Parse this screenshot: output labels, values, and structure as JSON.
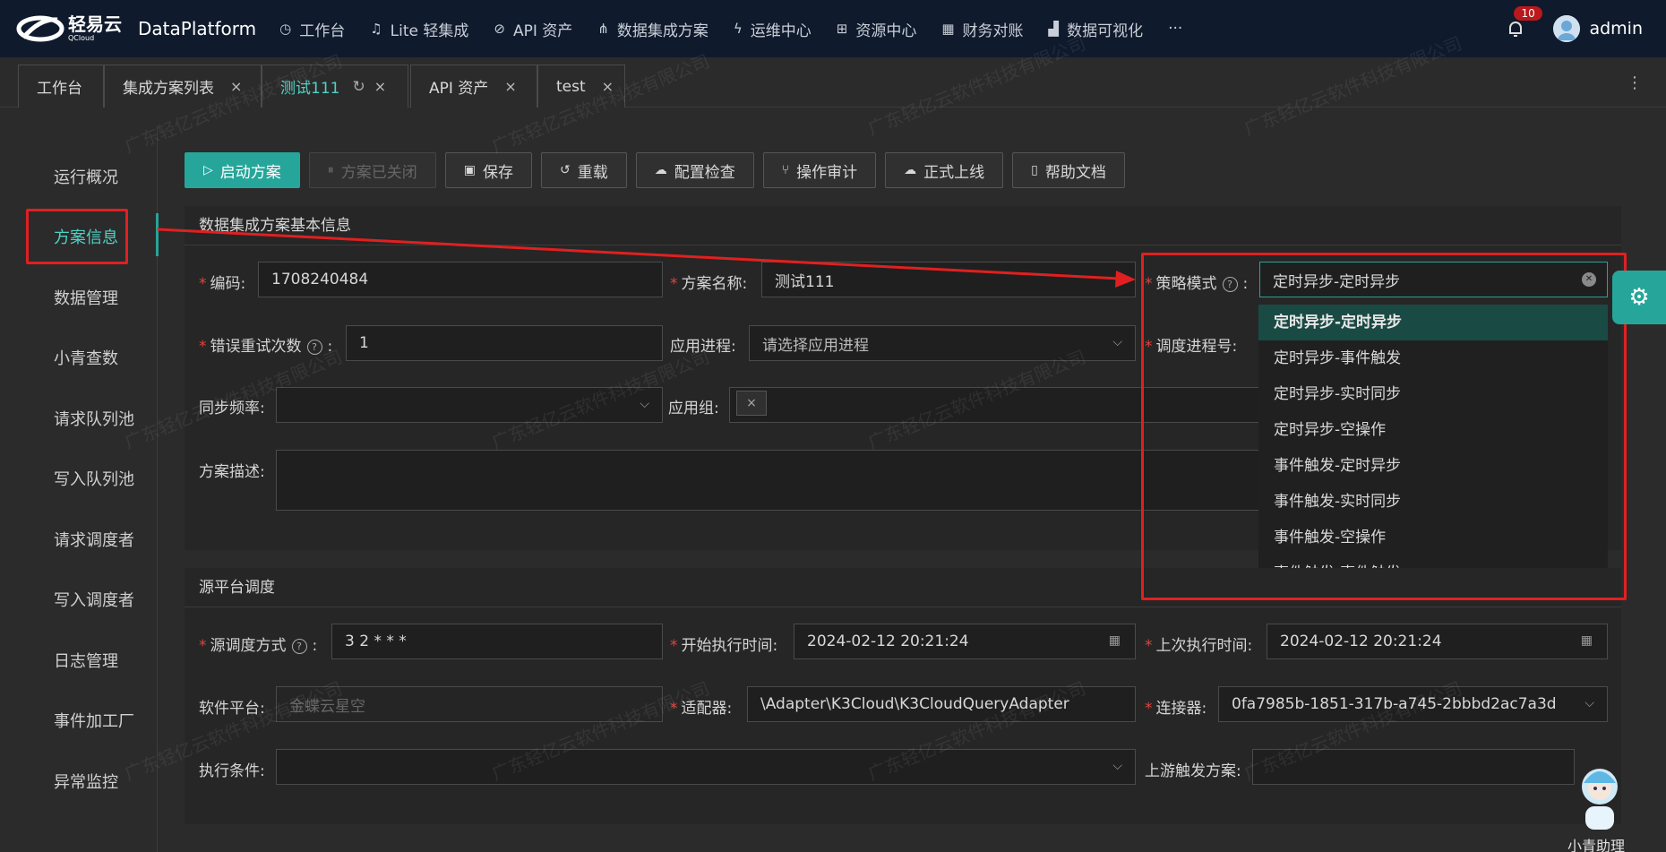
{
  "header": {
    "logo_cn": "轻易云",
    "logo_en": "QCloud",
    "brand": "DataPlatform",
    "nav": [
      {
        "label": "工作台",
        "icon": "clock-icon"
      },
      {
        "label": "Lite 轻集成",
        "icon": "bell-icon"
      },
      {
        "label": "API 资产",
        "icon": "compass-icon"
      },
      {
        "label": "数据集成方案",
        "icon": "share-icon"
      },
      {
        "label": "运维中心",
        "icon": "bolt-icon"
      },
      {
        "label": "资源中心",
        "icon": "sitemap-icon"
      },
      {
        "label": "财务对账",
        "icon": "calculator-icon"
      },
      {
        "label": "数据可视化",
        "icon": "chart-icon"
      }
    ],
    "more": "···",
    "notification_count": "10",
    "user": "admin"
  },
  "tabs": [
    {
      "label": "工作台"
    },
    {
      "label": "集成方案列表",
      "close": "×"
    },
    {
      "label": "测试111",
      "close": "×"
    },
    {
      "label": "API 资产",
      "close": "×"
    },
    {
      "label": "test",
      "close": "×"
    }
  ],
  "sidebar": {
    "items": [
      "运行概况",
      "方案信息",
      "数据管理",
      "小青查数",
      "请求队列池",
      "写入队列池",
      "请求调度者",
      "写入调度者",
      "日志管理",
      "事件加工厂",
      "异常监控"
    ],
    "active_index": 1
  },
  "toolbar": {
    "start": "启动方案",
    "closed": "方案已关闭",
    "save": "保存",
    "reload": "重载",
    "check": "配置检查",
    "audit": "操作审计",
    "online": "正式上线",
    "help": "帮助文档"
  },
  "basic": {
    "title": "数据集成方案基本信息",
    "code_label": "编码:",
    "code_value": "1708240484",
    "name_label": "方案名称:",
    "name_value": "测试111",
    "strategy_label": "策略模式",
    "strategy_value": "定时异步-定时异步",
    "retry_label": "错误重试次数",
    "retry_value": "1",
    "process_label": "应用进程:",
    "process_placeholder": "请选择应用进程",
    "sched_label": "调度进程号:",
    "freq_label": "同步频率:",
    "group_label": "应用组:",
    "desc_label": "方案描述:",
    "dropdown_options": [
      "定时异步-定时异步",
      "定时异步-事件触发",
      "定时异步-实时同步",
      "定时异步-空操作",
      "事件触发-定时异步",
      "事件触发-实时同步",
      "事件触发-空操作",
      "事件触发-事件触发"
    ]
  },
  "source": {
    "title": "源平台调度",
    "mode_label": "源调度方式",
    "mode_value": "3 2 * * *",
    "start_label": "开始执行时间:",
    "start_value": "2024-02-12 20:21:24",
    "last_label": "上次执行时间:",
    "last_value": "2024-02-12 20:21:24",
    "platform_label": "软件平台:",
    "platform_value": "金蝶云星空",
    "adapter_label": "适配器:",
    "adapter_value": "\\Adapter\\K3Cloud\\K3CloudQueryAdapter",
    "connector_label": "连接器:",
    "connector_value": "0fa7985b-1851-317b-a745-2bbbd2ac7a3d",
    "cond_label": "执行条件:",
    "upstream_label": "上游触发方案:"
  },
  "assistant_label": "小青助理",
  "watermark": "广东轻亿云软件科技有限公司",
  "colors": {
    "accent": "#26a69a",
    "highlight": "#e02020",
    "topbar": "#0f1a2c"
  }
}
